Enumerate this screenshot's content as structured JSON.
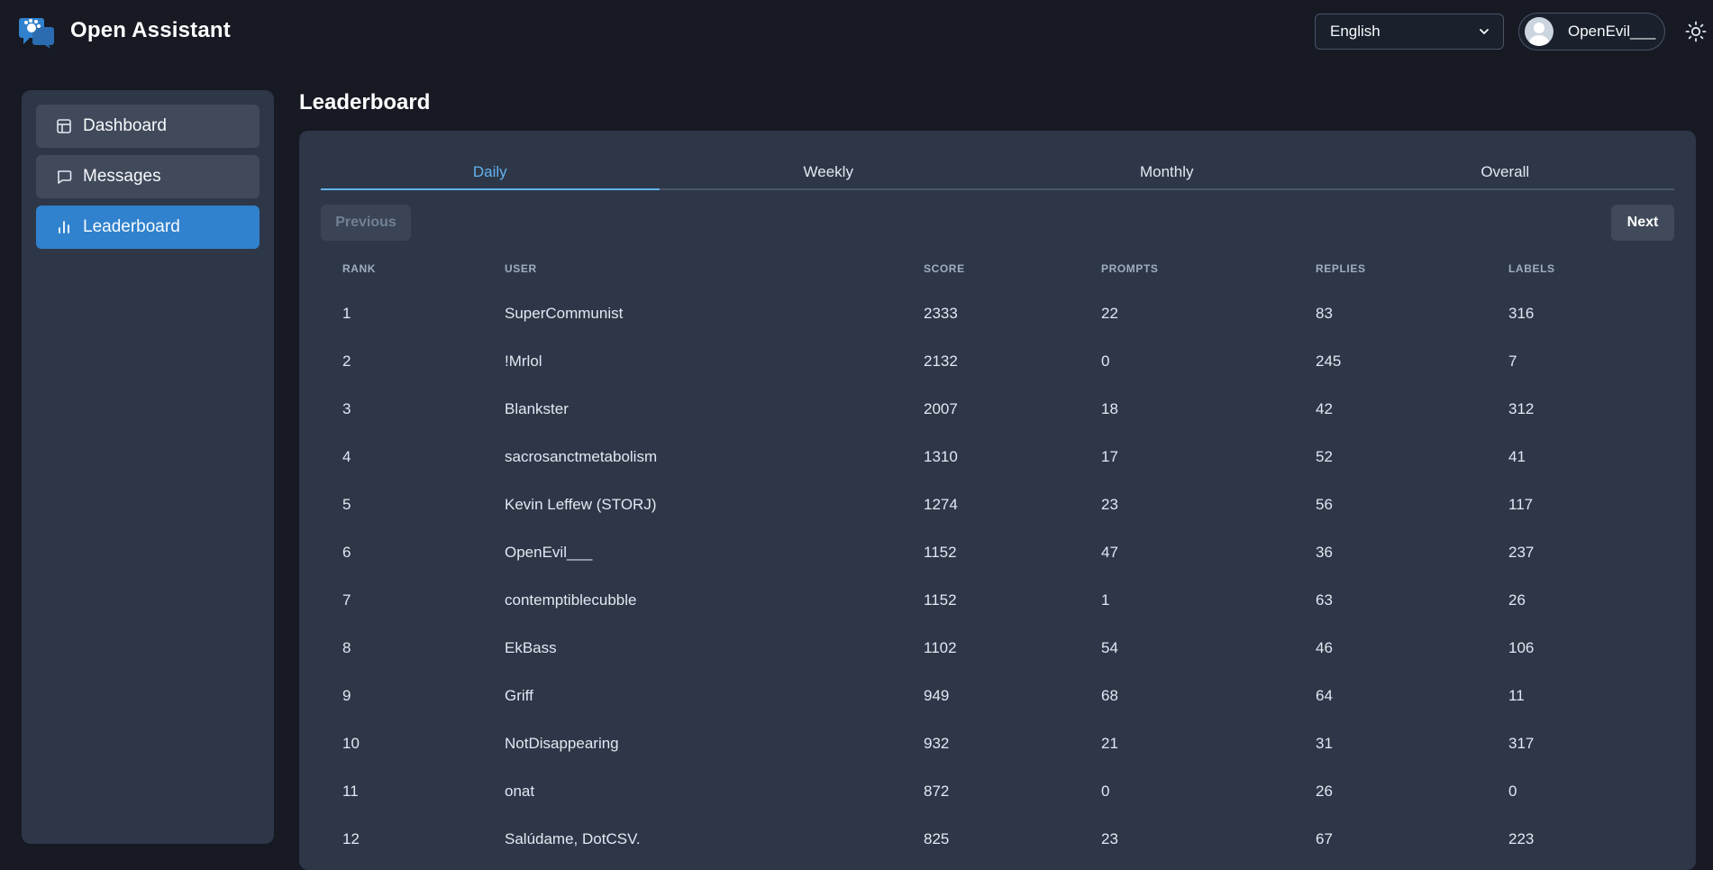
{
  "app": {
    "title": "Open Assistant"
  },
  "header": {
    "language": "English",
    "user_name": "OpenEvil___"
  },
  "sidebar": {
    "items": [
      {
        "label": "Dashboard",
        "icon": "layout-icon",
        "active": false
      },
      {
        "label": "Messages",
        "icon": "message-icon",
        "active": false
      },
      {
        "label": "Leaderboard",
        "icon": "bar-chart-icon",
        "active": true
      }
    ]
  },
  "main": {
    "title": "Leaderboard",
    "tabs": [
      {
        "label": "Daily",
        "active": true
      },
      {
        "label": "Weekly",
        "active": false
      },
      {
        "label": "Monthly",
        "active": false
      },
      {
        "label": "Overall",
        "active": false
      }
    ],
    "prev_label": "Previous",
    "next_label": "Next",
    "columns": [
      "RANK",
      "USER",
      "SCORE",
      "PROMPTS",
      "REPLIES",
      "LABELS"
    ],
    "rows": [
      [
        "1",
        "SuperCommunist",
        "2333",
        "22",
        "83",
        "316"
      ],
      [
        "2",
        "!Mrlol",
        "2132",
        "0",
        "245",
        "7"
      ],
      [
        "3",
        "Blankster",
        "2007",
        "18",
        "42",
        "312"
      ],
      [
        "4",
        "sacrosanctmetabolism",
        "1310",
        "17",
        "52",
        "41"
      ],
      [
        "5",
        "Kevin Leffew (STORJ)",
        "1274",
        "23",
        "56",
        "117"
      ],
      [
        "6",
        "OpenEvil___",
        "1152",
        "47",
        "36",
        "237"
      ],
      [
        "7",
        "contemptiblecubble",
        "1152",
        "1",
        "63",
        "26"
      ],
      [
        "8",
        "EkBass",
        "1102",
        "54",
        "46",
        "106"
      ],
      [
        "9",
        "Griff",
        "949",
        "68",
        "64",
        "11"
      ],
      [
        "10",
        "NotDisappearing",
        "932",
        "21",
        "31",
        "317"
      ],
      [
        "11",
        "onat",
        "872",
        "0",
        "26",
        "0"
      ],
      [
        "12",
        "Salúdame, DotCSV.",
        "825",
        "23",
        "67",
        "223"
      ]
    ]
  },
  "colors": {
    "background": "#171923",
    "panel": "#2d3748",
    "accent": "#3182ce",
    "tab_active": "#63b3ed"
  }
}
